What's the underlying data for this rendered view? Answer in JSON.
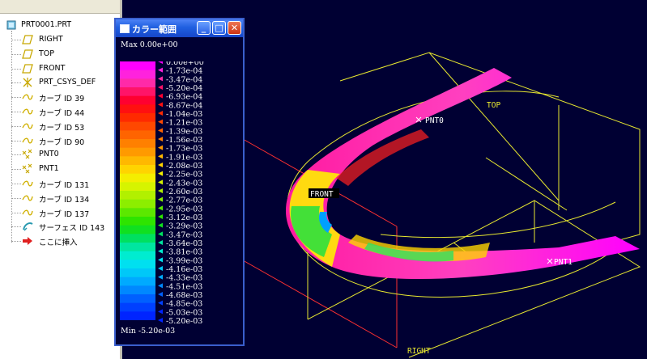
{
  "tree": {
    "root": "PRT0001.PRT",
    "items": [
      {
        "label": "RIGHT",
        "icon": "datum-plane-icon"
      },
      {
        "label": "TOP",
        "icon": "datum-plane-icon"
      },
      {
        "label": "FRONT",
        "icon": "datum-plane-icon"
      },
      {
        "label": "PRT_CSYS_DEF",
        "icon": "csys-icon"
      },
      {
        "label": "カーブ ID 39",
        "icon": "curve-icon"
      },
      {
        "label": "カーブ ID 44",
        "icon": "curve-icon"
      },
      {
        "label": "カーブ ID 53",
        "icon": "curve-icon"
      },
      {
        "label": "カーブ ID 90",
        "icon": "curve-icon"
      },
      {
        "label": "PNT0",
        "icon": "datum-point-icon"
      },
      {
        "label": "PNT1",
        "icon": "datum-point-icon"
      },
      {
        "label": "カーブ ID 131",
        "icon": "curve-icon"
      },
      {
        "label": "カーブ ID 134",
        "icon": "curve-icon"
      },
      {
        "label": "カーブ ID 137",
        "icon": "curve-icon"
      },
      {
        "label": "サーフェス ID 143",
        "icon": "surface-icon"
      },
      {
        "label": "ここに挿入",
        "icon": "insert-arrow-icon"
      }
    ]
  },
  "color_window": {
    "title": "カラー範囲",
    "buttons": {
      "minimize": "_",
      "maximize": "□",
      "close": "✕"
    },
    "max_label": "Max  0.00e+00",
    "min_label": "Min -5.20e-03",
    "levels": [
      "0.00e+00",
      "-1.73e-04",
      "-3.47e-04",
      "-5.20e-04",
      "-6.93e-04",
      "-8.67e-04",
      "-1.04e-03",
      "-1.21e-03",
      "-1.39e-03",
      "-1.56e-03",
      "-1.73e-03",
      "-1.91e-03",
      "-2.08e-03",
      "-2.25e-03",
      "-2.43e-03",
      "-2.60e-03",
      "-2.77e-03",
      "-2.95e-03",
      "-3.12e-03",
      "-3.29e-03",
      "-3.47e-03",
      "-3.64e-03",
      "-3.81e-03",
      "-3.99e-03",
      "-4.16e-03",
      "-4.33e-03",
      "-4.51e-03",
      "-4.68e-03",
      "-4.85e-03",
      "-5.03e-03",
      "-5.20e-03"
    ],
    "band_colors": [
      "#ff00ff",
      "#ff22dd",
      "#ff2aa8",
      "#ff1468",
      "#ff0030",
      "#ff1010",
      "#ff2a00",
      "#ff4800",
      "#ff6400",
      "#ff8000",
      "#ff9a00",
      "#ffb800",
      "#ffd400",
      "#f4ee00",
      "#d6f400",
      "#b2f000",
      "#8cee00",
      "#5ce800",
      "#2ee400",
      "#10e020",
      "#00e060",
      "#00e6a0",
      "#00ecd0",
      "#00e0f0",
      "#00c8f8",
      "#00aaff",
      "#0088ff",
      "#0060ff",
      "#0040ff",
      "#0024ff"
    ]
  },
  "model": {
    "labels": {
      "pnt0": "PNT0",
      "pnt1": "PNT1",
      "front": "FRONT",
      "top": "TOP",
      "right": "RIGHT"
    },
    "colors": {
      "datum": "#e8e830",
      "outline": "#ff3030",
      "background": "#000033"
    }
  }
}
